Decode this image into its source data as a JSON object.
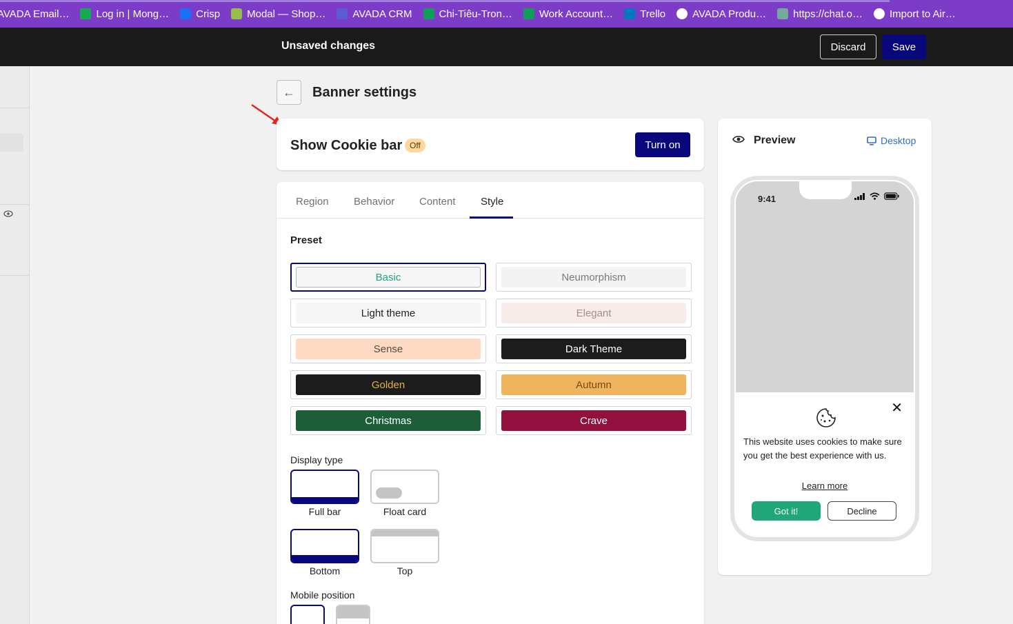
{
  "bookmarks": [
    {
      "label": "AVADA Email…",
      "icon": "avada-icon",
      "color": "#7d3cc8"
    },
    {
      "label": "Log in | Mong…",
      "icon": "mongodb-leaf-icon",
      "color": "#13aa52"
    },
    {
      "label": "Crisp",
      "icon": "crisp-chat-icon",
      "color": "#1972f5"
    },
    {
      "label": "Modal — Shop…",
      "icon": "shopify-bag-icon",
      "color": "#95bf47"
    },
    {
      "label": "AVADA CRM",
      "icon": "avada-crm-icon",
      "color": "#5b5bd6"
    },
    {
      "label": "Chi-Tiêu-Tron…",
      "icon": "google-sheets-icon",
      "color": "#0f9d58"
    },
    {
      "label": "Work Account…",
      "icon": "google-sheets-icon",
      "color": "#0f9d58"
    },
    {
      "label": "Trello",
      "icon": "trello-icon",
      "color": "#0079bf"
    },
    {
      "label": "AVADA Produ…",
      "icon": "google-icon",
      "color": "#ffffff"
    },
    {
      "label": "https://chat.o…",
      "icon": "chatgpt-icon",
      "color": "#74aa9c"
    },
    {
      "label": "Import to Air…",
      "icon": "globe-icon",
      "color": "#ffffff"
    }
  ],
  "savebar": {
    "title": "Unsaved changes",
    "discard_label": "Discard",
    "save_label": "Save"
  },
  "page": {
    "title": "Banner settings"
  },
  "cookie_bar": {
    "label": "Show Cookie bar",
    "status": "Off",
    "turn_on_label": "Turn on"
  },
  "tabs": [
    "Region",
    "Behavior",
    "Content",
    "Style"
  ],
  "active_tab": "Style",
  "preset": {
    "title": "Preset",
    "items": [
      {
        "label": "Basic",
        "bg": "#f6f6f7",
        "fg": "#21a679",
        "selected": true
      },
      {
        "label": "Neumorphism",
        "bg": "#f3f3f3",
        "fg": "#7a7a7a",
        "selected": false
      },
      {
        "label": "Light theme",
        "bg": "#f6f6f7",
        "fg": "#202223",
        "selected": false
      },
      {
        "label": "Elegant",
        "bg": "#f7ece9",
        "fg": "#a58f86",
        "selected": false
      },
      {
        "label": "Sense",
        "bg": "#fedac4",
        "fg": "#5a4a40",
        "selected": false
      },
      {
        "label": "Dark Theme",
        "bg": "#1c1c1c",
        "fg": "#ffffff",
        "selected": false
      },
      {
        "label": "Golden",
        "bg": "#1c1c1c",
        "fg": "#e2b23f",
        "selected": false
      },
      {
        "label": "Autumn",
        "bg": "#efb45e",
        "fg": "#7a4a12",
        "selected": false
      },
      {
        "label": "Christmas",
        "bg": "#1b5e38",
        "fg": "#ffffff",
        "selected": false
      },
      {
        "label": "Crave",
        "bg": "#930f3e",
        "fg": "#ffffff",
        "selected": false
      }
    ]
  },
  "display_type": {
    "title": "Display type",
    "options": [
      "Full bar",
      "Float card"
    ],
    "selected": "Full bar",
    "position_options": [
      "Bottom",
      "Top"
    ],
    "position_selected": "Bottom"
  },
  "mobile_position": {
    "title": "Mobile position"
  },
  "preview": {
    "title": "Preview",
    "device_label": "Desktop",
    "time": "9:41",
    "cookie_text": "This website uses cookies to make sure you get the best experience with us.",
    "learn_more": "Learn more",
    "accept_label": "Got it!",
    "decline_label": "Decline"
  },
  "colors": {
    "accent": "#08087c",
    "bookmarks_bg": "#7d3cc8",
    "accept_green": "#21a679",
    "badge_off": "#ffd79d"
  }
}
